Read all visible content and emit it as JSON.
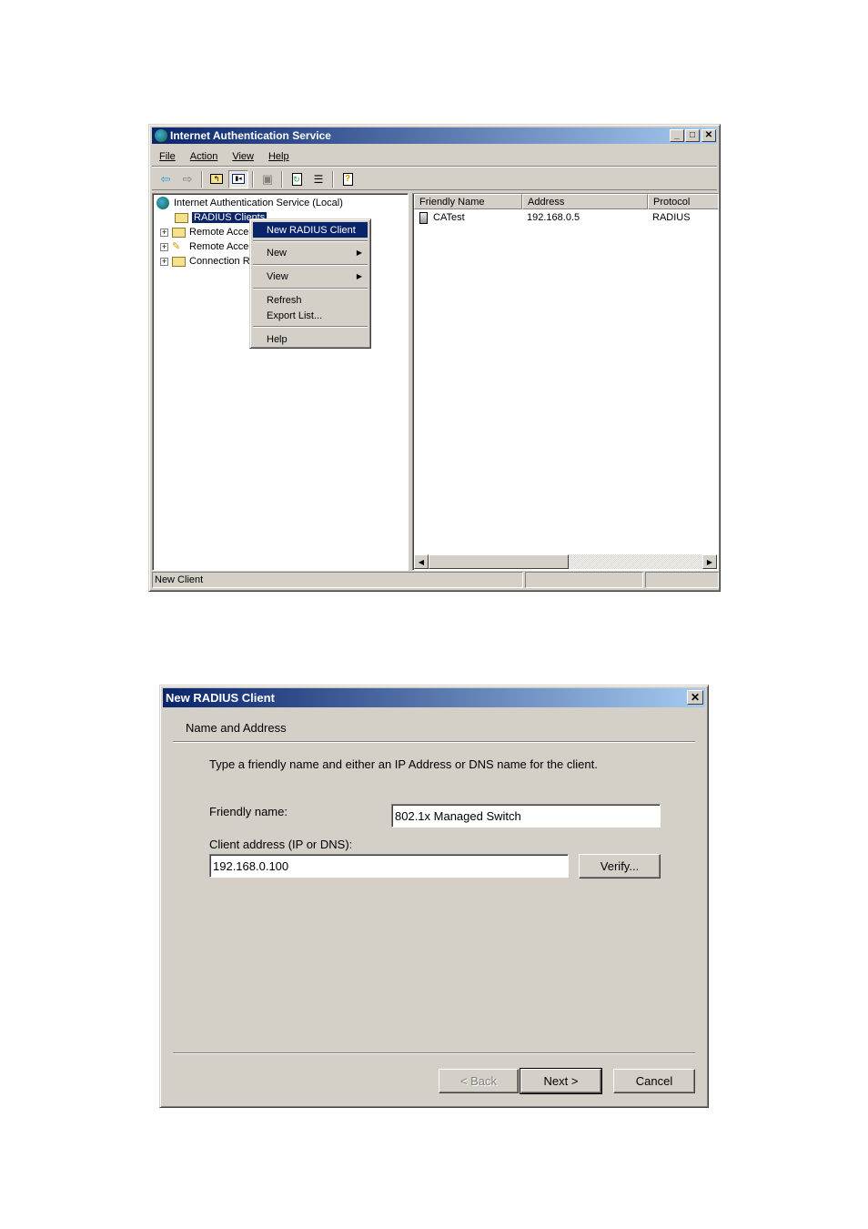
{
  "ias_window": {
    "title": "Internet Authentication Service",
    "title_buttons": [
      "minimize",
      "maximize",
      "close"
    ],
    "menu": [
      "File",
      "Action",
      "View",
      "Help"
    ],
    "toolbar_icons": [
      "back-arrow-icon",
      "forward-arrow-icon",
      "up-folder-icon",
      "show-hide-tree-icon",
      "delete-icon",
      "refresh-icon",
      "export-list-icon",
      "help-icon"
    ],
    "tree": {
      "root": "Internet Authentication Service (Local)",
      "items": [
        {
          "label": "RADIUS Clients",
          "selected": true
        },
        {
          "label": "Remote Acce",
          "expandable": true
        },
        {
          "label": "Remote Acce",
          "expandable": true
        },
        {
          "label": "Connection R",
          "expandable": true
        }
      ]
    },
    "context_menu": {
      "items": [
        {
          "label": "New RADIUS Client",
          "highlighted": true
        },
        {
          "label": "New",
          "submenu": true
        },
        {
          "label": "View",
          "submenu": true
        },
        {
          "label": "Refresh"
        },
        {
          "label": "Export List..."
        },
        {
          "label": "Help"
        }
      ]
    },
    "list": {
      "columns": [
        "Friendly Name",
        "Address",
        "Protocol"
      ],
      "rows": [
        {
          "name": "CATest",
          "address": "192.168.0.5",
          "protocol": "RADIUS"
        }
      ]
    },
    "status": {
      "text": "New Client",
      "panel2": "",
      "panel3": ""
    }
  },
  "dialog": {
    "title": "New RADIUS Client",
    "section_title": "Name and Address",
    "instruction": "Type a friendly name and either an IP Address or DNS name for the client.",
    "friendly_name_label": "Friendly name:",
    "friendly_name_value": "802.1x Managed Switch",
    "client_address_label": "Client address (IP or DNS):",
    "client_address_value": "192.168.0.100",
    "verify_button": "Verify...",
    "back_button": "< Back",
    "next_button": "Next >",
    "cancel_button": "Cancel"
  }
}
